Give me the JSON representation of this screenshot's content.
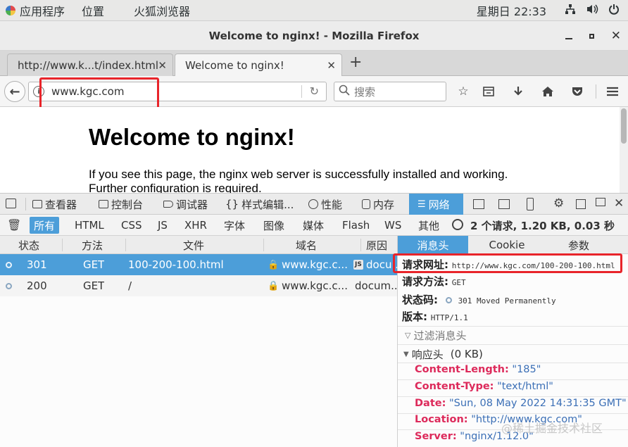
{
  "topbar": {
    "apps_label": "应用程序",
    "places_label": "位置",
    "browser_label": "火狐浏览器",
    "clock": "星期日 22:33"
  },
  "window": {
    "title": "Welcome to nginx! - Mozilla Firefox"
  },
  "tabs": [
    {
      "label": "http://www.k...t/index.html"
    },
    {
      "label": "Welcome to nginx!"
    }
  ],
  "navbar": {
    "url": "www.kgc.com",
    "search_placeholder": "搜索"
  },
  "page": {
    "heading": "Welcome to nginx!",
    "paragraph": "If you see this page, the nginx web server is successfully installed and working. Further configuration is required."
  },
  "devtools": {
    "tabs": [
      "查看器",
      "控制台",
      "调试器",
      "样式编辑...",
      "性能",
      "内存",
      "网络"
    ],
    "filters": [
      "所有",
      "HTML",
      "CSS",
      "JS",
      "XHR",
      "字体",
      "图像",
      "媒体",
      "Flash",
      "WS",
      "其他"
    ],
    "summary": "2 个请求, 1.20 KB, 0.03 秒",
    "columns": [
      "状态",
      "方法",
      "文件",
      "域名",
      "原因"
    ],
    "requests": [
      {
        "status": "301",
        "method": "GET",
        "file": "100-200-100.html",
        "domain": "www.kgc.c...",
        "cause": "docu..."
      },
      {
        "status": "200",
        "method": "GET",
        "file": "/",
        "domain": "www.kgc.c...",
        "cause": "docum..."
      }
    ],
    "side_tabs": [
      "消息头",
      "Cookie",
      "参数"
    ],
    "request_url_label": "请求网址:",
    "request_url": "http://www.kgc.com/100-200-100.html",
    "request_method_label": "请求方法:",
    "request_method": "GET",
    "status_code_label": "状态码:",
    "status_code": "301 Moved Permanently",
    "version_label": "版本:",
    "version": "HTTP/1.1",
    "filter_headers_placeholder": "过滤消息头",
    "response_headers_label": "响应头",
    "response_headers_size": "(0 KB)",
    "response_headers": [
      {
        "key": "Content-Length:",
        "value": "\"185\""
      },
      {
        "key": "Content-Type:",
        "value": "\"text/html\""
      },
      {
        "key": "Date:",
        "value": "\"Sun, 08 May 2022 14:31:35 GMT\""
      },
      {
        "key": "Location:",
        "value": "\"http://www.kgc.com\""
      },
      {
        "key": "Server:",
        "value": "\"nginx/1.12.0\""
      }
    ]
  },
  "watermark": "@稀土掘金技术社区",
  "colors": {
    "accent": "#4c9ed9",
    "highlight_box": "#e8242a",
    "header_key": "#dd2a5b",
    "header_value": "#3b6fb6"
  }
}
